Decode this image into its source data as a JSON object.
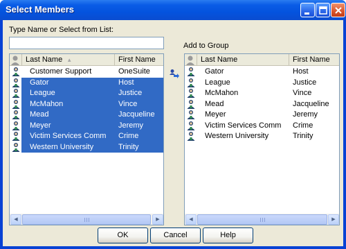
{
  "window": {
    "title": "Select Members"
  },
  "search": {
    "label": "Type Name or Select from List:",
    "value": ""
  },
  "add_to_group_label": "Add to Group",
  "columns": {
    "last_name": "Last Name",
    "first_name": "First Name"
  },
  "left_list": [
    {
      "last": "Customer Support",
      "first": "OneSuite",
      "selected": false
    },
    {
      "last": "Gator",
      "first": "Host",
      "selected": true
    },
    {
      "last": "League",
      "first": "Justice",
      "selected": true
    },
    {
      "last": "McMahon",
      "first": "Vince",
      "selected": true
    },
    {
      "last": "Mead",
      "first": "Jacqueline",
      "selected": true
    },
    {
      "last": "Meyer",
      "first": "Jeremy",
      "selected": true
    },
    {
      "last": "Victim Services Comm",
      "first": "Crime",
      "selected": true
    },
    {
      "last": "Western University",
      "first": "Trinity",
      "selected": true
    }
  ],
  "right_list": [
    {
      "last": "Gator",
      "first": "Host"
    },
    {
      "last": "League",
      "first": "Justice"
    },
    {
      "last": "McMahon",
      "first": "Vince"
    },
    {
      "last": "Mead",
      "first": "Jacqueline"
    },
    {
      "last": "Meyer",
      "first": "Jeremy"
    },
    {
      "last": "Victim Services Comm",
      "first": "Crime"
    },
    {
      "last": "Western University",
      "first": "Trinity"
    }
  ],
  "buttons": {
    "ok": "OK",
    "cancel": "Cancel",
    "help": "Help"
  },
  "colors": {
    "selection": "#316ac5",
    "titlebar": "#0a5ce6",
    "dialog": "#ece9d8"
  },
  "icons": {
    "person": "person-icon",
    "add": "add-to-group-icon"
  }
}
